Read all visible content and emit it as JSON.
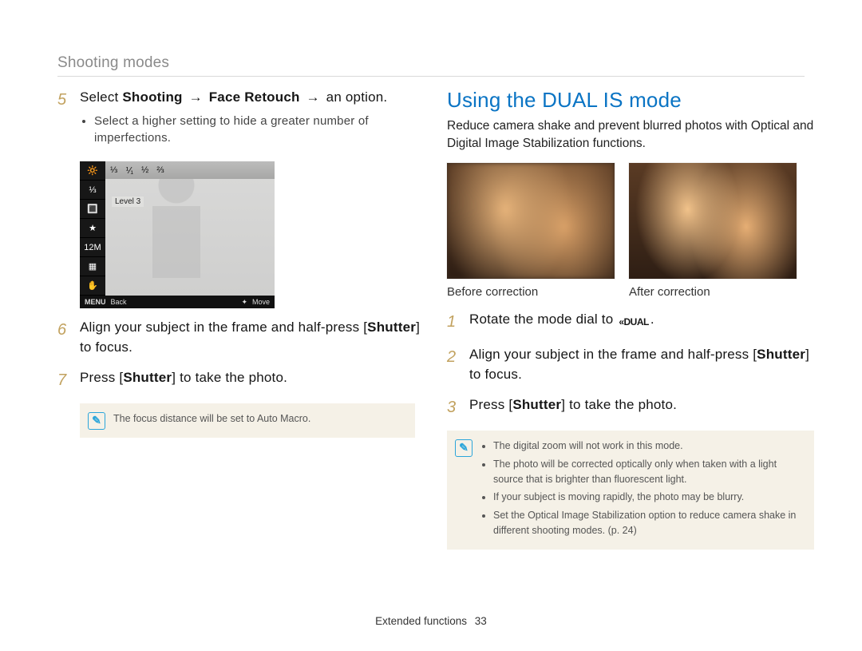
{
  "header": {
    "running_title": "Shooting modes"
  },
  "left": {
    "step5": {
      "select": "Select",
      "shooting": "Shooting",
      "arrow": "→",
      "face_retouch": "Face Retouch",
      "an_option": "an option.",
      "bullet": "Select a higher setting to hide a greater number of imperfections."
    },
    "lcd": {
      "topbar": [
        "⅓",
        "⅟₁",
        "½",
        "⅔"
      ],
      "level_row": "Level 3",
      "bl_label": "Back",
      "br_label": "Move",
      "menu": "MENU",
      "left_icons": [
        "🔆",
        "⅓",
        "🔳",
        "★",
        "12M",
        "▦",
        "✋"
      ]
    },
    "step6": {
      "num": "6",
      "text_a": "Align your subject in the frame and half-press [",
      "shutter": "Shutter",
      "text_b": "] to focus."
    },
    "step7": {
      "num": "7",
      "text_a": "Press [",
      "shutter": "Shutter",
      "text_b": "] to take the photo."
    },
    "note": "The focus distance will be set to Auto Macro."
  },
  "right": {
    "heading": "Using the DUAL IS mode",
    "lede": "Reduce camera shake and prevent blurred photos with Optical and Digital Image Stabilization functions.",
    "cap1": "Before correction",
    "cap2": "After correction",
    "step1": {
      "num": "1",
      "text": "Rotate the mode dial to ",
      "dual_icon": "«DUAL",
      "period": "."
    },
    "step2": {
      "num": "2",
      "text_a": "Align your subject in the frame and half-press [",
      "shutter": "Shutter",
      "text_b": "] to focus."
    },
    "step3": {
      "num": "3",
      "text_a": "Press [",
      "shutter": "Shutter",
      "text_b": "] to take the photo."
    },
    "notes": [
      "The digital zoom will not work in this mode.",
      "The photo will be corrected optically only when taken with a light source that is brighter than fluorescent light.",
      "If your subject is moving rapidly, the photo may be blurry.",
      "Set the Optical Image Stabilization option to reduce camera shake in different shooting modes. (p. 24)"
    ]
  },
  "footer": {
    "section": "Extended functions",
    "page": "33"
  }
}
